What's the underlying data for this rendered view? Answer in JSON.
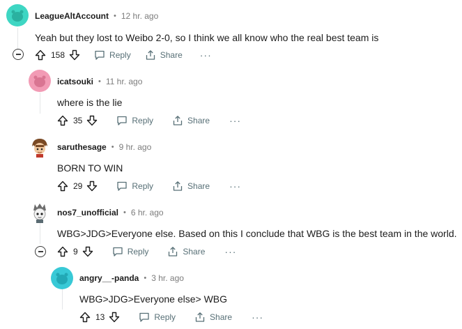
{
  "comments": [
    {
      "author": "LeagueAltAccount",
      "time": "12 hr. ago",
      "text": "Yeah but they lost to Weibo 2-0, so I think we all know who the real best team is",
      "votes": "158",
      "avatar_color": "#3ed6c3"
    },
    {
      "author": "icatsouki",
      "time": "11 hr. ago",
      "text": "where is the lie",
      "votes": "35",
      "avatar_color": "#f29bb5"
    },
    {
      "author": "saruthesage",
      "time": "9 hr. ago",
      "text": "BORN TO WIN",
      "votes": "29",
      "avatar_color": "#8a5a35"
    },
    {
      "author": "nos7_unofficial",
      "time": "6 hr. ago",
      "text": "WBG>JDG>Everyone else. Based on this I conclude that WBG is the best team in the world.",
      "votes": "9",
      "avatar_color": "#9aa3a8"
    },
    {
      "author": "angry__-panda",
      "time": "3 hr. ago",
      "text": "WBG>JDG>Everyone else> WBG",
      "votes": "13",
      "avatar_color": "#38c9d6"
    }
  ],
  "actions": {
    "reply_label": "Reply",
    "share_label": "Share",
    "more_label": "···"
  },
  "separator": "•"
}
